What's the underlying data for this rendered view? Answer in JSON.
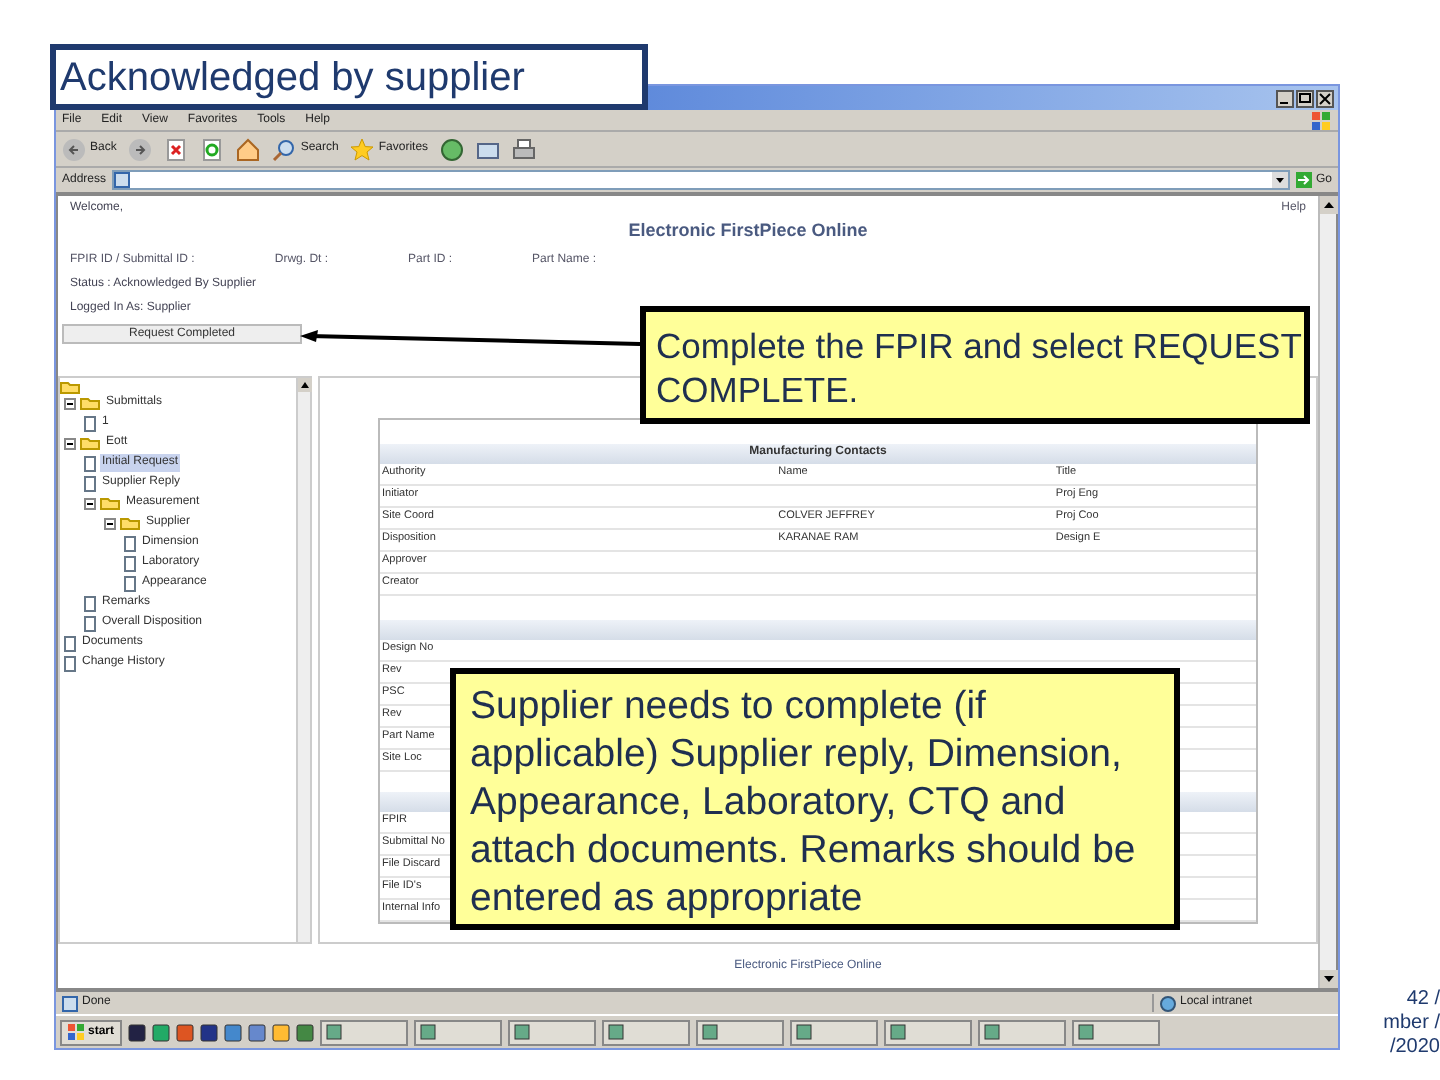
{
  "slide": {
    "title": "Acknowledged by supplier",
    "page_number": [
      "42 /",
      "mber /",
      "/2020"
    ]
  },
  "browser": {
    "menu": [
      "File",
      "Edit",
      "View",
      "Favorites",
      "Tools",
      "Help"
    ],
    "toolbar": [
      {
        "kind": "back",
        "label": "Back"
      },
      {
        "kind": "forward"
      },
      {
        "kind": "stop"
      },
      {
        "kind": "refresh"
      },
      {
        "kind": "home"
      },
      {
        "kind": "search",
        "label": "Search"
      },
      {
        "kind": "favorites",
        "label": "Favorites"
      },
      {
        "kind": "media"
      },
      {
        "kind": "mail"
      },
      {
        "kind": "print"
      }
    ],
    "address_label": "Address",
    "go": "Go"
  },
  "page": {
    "welcome": "Welcome,",
    "app_title": "Electronic FirstPiece Online",
    "help": "Help",
    "info": [
      "FPIR ID / Submittal ID :",
      "Drwg. Dt :",
      "Part ID :",
      "Part Name :"
    ],
    "status": "Status : Acknowledged By Supplier",
    "logged_in": "Logged In As: Supplier",
    "request_button": "Request Completed",
    "tree": [
      {
        "label": "Submittals",
        "kind": "folder",
        "expanded": true,
        "selected": false,
        "children": [
          {
            "label": "1",
            "kind": "doc",
            "selected": false
          }
        ]
      },
      {
        "label": "Eott",
        "kind": "folder",
        "expanded": true,
        "selected": false,
        "children": [
          {
            "label": "Initial Request",
            "kind": "doc",
            "selected": true
          },
          {
            "label": "Supplier Reply",
            "kind": "doc",
            "selected": false
          },
          {
            "label": "Measurement",
            "kind": "folder",
            "expanded": true,
            "selected": false,
            "children": [
              {
                "label": "Supplier",
                "kind": "folder",
                "expanded": true,
                "selected": false,
                "children": [
                  {
                    "label": "Dimension",
                    "kind": "doc",
                    "selected": false
                  },
                  {
                    "label": "Laboratory",
                    "kind": "doc",
                    "selected": false
                  },
                  {
                    "label": "Appearance",
                    "kind": "doc",
                    "selected": false
                  }
                ]
              }
            ]
          },
          {
            "label": "Remarks",
            "kind": "doc",
            "selected": false
          },
          {
            "label": "Overall Disposition",
            "kind": "doc",
            "selected": false
          }
        ]
      },
      {
        "label": "Documents",
        "kind": "doc",
        "selected": false
      },
      {
        "label": "Change History",
        "kind": "doc",
        "selected": false
      }
    ],
    "contacts": {
      "title": "Manufacturing Contacts",
      "columns": [
        "Authority",
        "Name",
        "Title"
      ],
      "rows": [
        [
          "Initiator",
          "",
          "Proj Eng"
        ],
        [
          "Site Coord",
          "COLVER JEFFREY",
          "Proj Coo"
        ],
        [
          "Disposition",
          "KARANAE RAM",
          "Design E"
        ],
        [
          "Approver",
          "",
          ""
        ],
        [
          "Creator",
          "",
          ""
        ]
      ]
    },
    "details": [
      "Design No",
      "Rev",
      "PSC",
      "Rev",
      "Part Name",
      "Site Loc"
    ],
    "files": [
      "FPIR",
      "Submittal No",
      "File Discard",
      "File ID's",
      "Internal Info"
    ],
    "footer": "Electronic FirstPiece Online"
  },
  "status_bar": {
    "text": "Done",
    "zone": "Local intranet"
  },
  "taskbar": {
    "start": "start"
  },
  "callouts": [
    {
      "text": "Complete the FPIR and select REQUEST COMPLETE.",
      "arrow": true
    },
    {
      "text": "Supplier needs to complete (if applicable) Supplier reply, Dimension, Appearance, Laboratory, CTQ and attach documents.  Remarks should be entered as appropriate",
      "arrow": false
    }
  ]
}
